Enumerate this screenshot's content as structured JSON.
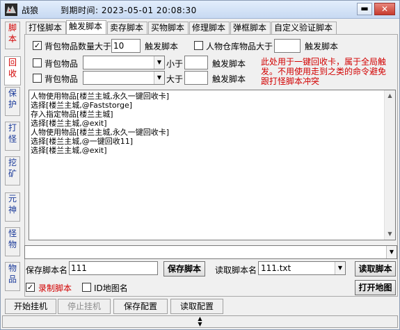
{
  "window": {
    "title": "战狼",
    "expire_text": "到期时间: 2023-05-01  20:08:30",
    "minimize_label": "▬",
    "close_label": "✕"
  },
  "side_tabs": [
    "脚本",
    "回收",
    "保护",
    "打怪",
    "挖矿",
    "元神",
    "怪物",
    "物品"
  ],
  "top_tabs": [
    "打怪脚本",
    "触发脚本",
    "卖存脚本",
    "买物脚本",
    "修理脚本",
    "弹框脚本",
    "自定义验证脚本"
  ],
  "trigger": {
    "row1": {
      "checked": "✓",
      "label": "背包物品数量大于",
      "value": "10",
      "action": "触发脚本"
    },
    "row1b": {
      "label": "人物仓库物品大于",
      "value": "",
      "action": "触发脚本"
    },
    "row2": {
      "label": "背包物品",
      "compare": "小于",
      "value": "",
      "action": "触发脚本"
    },
    "row3": {
      "label": "背包物品",
      "compare": "大于",
      "value": "",
      "action": "触发脚本"
    },
    "note": "此处用于一键回收卡，属于全局触发。不用使用走到之类的命令避免跟打怪脚本冲突"
  },
  "script_lines": [
    "人物使用物品[楼兰主城,永久一键回收卡]",
    "选择[楼兰主城,@Faststorge]",
    "存入指定物品[楼兰主城]",
    "选择[楼兰主城,@exit]",
    "人物使用物品[楼兰主城,永久一键回收卡]",
    "选择[楼兰主城,@一键回收11]",
    "选择[楼兰主城,@exit]"
  ],
  "save": {
    "label": "保存脚本名",
    "value": "111",
    "button": "保存脚本"
  },
  "load": {
    "label": "读取脚本名",
    "value": "111.txt",
    "button": "读取脚本"
  },
  "options": {
    "record_checked": "✓",
    "record_label": "录制脚本",
    "map_label": "ID地图名",
    "open_map": "打开地图"
  },
  "bottom_buttons": [
    "开始挂机",
    "停止挂机",
    "保存配置",
    "读取配置"
  ],
  "colors": {
    "accent_red": "#d20000",
    "note_red": "#d20000"
  },
  "icons": {
    "app": "wolf-logo-icon"
  }
}
